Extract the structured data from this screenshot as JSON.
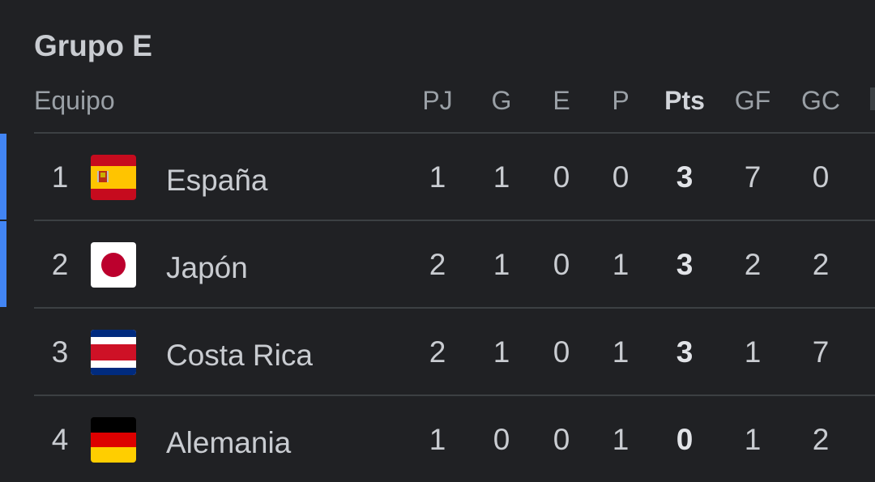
{
  "group_title": "Grupo E",
  "columns": {
    "team": "Equipo",
    "pj": "PJ",
    "g": "G",
    "e": "E",
    "p": "P",
    "pts": "Pts",
    "gf": "GF",
    "gc": "GC"
  },
  "colors": {
    "background": "#202124",
    "qualify_accent": "#4285f4",
    "divider": "#3c4043"
  },
  "rows": [
    {
      "pos": "1",
      "team": "España",
      "flag": "spain-flag-icon",
      "pj": "1",
      "g": "1",
      "e": "0",
      "p": "0",
      "pts": "3",
      "gf": "7",
      "gc": "0",
      "qualified": true
    },
    {
      "pos": "2",
      "team": "Japón",
      "flag": "japan-flag-icon",
      "pj": "2",
      "g": "1",
      "e": "0",
      "p": "1",
      "pts": "3",
      "gf": "2",
      "gc": "2",
      "qualified": true
    },
    {
      "pos": "3",
      "team": "Costa Rica",
      "flag": "costa-rica-flag-icon",
      "pj": "2",
      "g": "1",
      "e": "0",
      "p": "1",
      "pts": "3",
      "gf": "1",
      "gc": "7",
      "qualified": false
    },
    {
      "pos": "4",
      "team": "Alemania",
      "flag": "germany-flag-icon",
      "pj": "1",
      "g": "0",
      "e": "0",
      "p": "1",
      "pts": "0",
      "gf": "1",
      "gc": "2",
      "qualified": false
    }
  ]
}
